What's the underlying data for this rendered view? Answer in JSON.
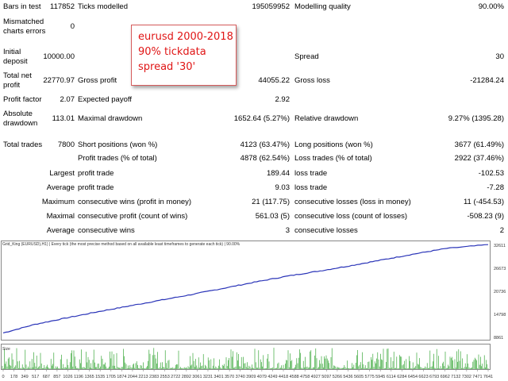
{
  "report": {
    "bars_label": "Bars in test",
    "bars_value": "117852",
    "ticks_label": "Ticks modelled",
    "ticks_value": "195059952",
    "quality_label": "Modelling quality",
    "quality_value": "90.00%",
    "mismatch_label": "Mismatched charts errors",
    "mismatch_value": "0",
    "deposit_label": "Initial deposit",
    "deposit_value": "10000.00",
    "spread_label": "Spread",
    "spread_value": "30",
    "netprofit_label": "Total net profit",
    "netprofit_value": "22770.97",
    "grossprofit_label": "Gross profit",
    "grossprofit_value": "44055.22",
    "grossloss_label": "Gross loss",
    "grossloss_value": "-21284.24",
    "pf_label": "Profit factor",
    "pf_value": "2.07",
    "ep_label": "Expected payoff",
    "ep_value": "2.92",
    "absdd_label": "Absolute drawdown",
    "absdd_value": "113.01",
    "maxdd_label": "Maximal drawdown",
    "maxdd_value": "1652.64 (5.27%)",
    "reldd_label": "Relative drawdown",
    "reldd_value": "9.27% (1395.28)",
    "trades_label": "Total trades",
    "trades_value": "7800",
    "short_label": "Short positions (won %)",
    "short_value": "4123 (63.47%)",
    "long_label": "Long positions (won %)",
    "long_value": "3677 (61.49%)",
    "pt_label": "Profit trades (% of total)",
    "pt_value": "4878 (62.54%)",
    "lt_label": "Loss trades (% of total)",
    "lt_value": "2922 (37.46%)",
    "largest": "Largest",
    "largest_pt_label": "profit trade",
    "largest_pt_value": "189.44",
    "largest_lt_label": "loss trade",
    "largest_lt_value": "-102.53",
    "average": "Average",
    "avg_pt_label": "profit trade",
    "avg_pt_value": "9.03",
    "avg_lt_label": "loss trade",
    "avg_lt_value": "-7.28",
    "maximum": "Maximum",
    "max_cw_label": "consecutive wins (profit in money)",
    "max_cw_value": "21 (117.75)",
    "max_cl_label": "consecutive losses (loss in money)",
    "max_cl_value": "11 (-454.53)",
    "maximal": "Maximal",
    "mal_cp_label": "consecutive profit (count of wins)",
    "mal_cp_value": "561.03 (5)",
    "mal_cl_label": "consecutive loss (count of losses)",
    "mal_cl_value": "-508.23 (9)",
    "average2": "Average",
    "avg_cw_label": "consecutive wins",
    "avg_cw_value": "3",
    "avg_cl_label": "consecutive losses",
    "avg_cl_value": "2"
  },
  "annotation": {
    "line1": "eurusd 2000-2018",
    "line2": "90% tickdata",
    "line3": "spread '30'"
  },
  "chart_header": "Grid_King (EURUSD),H1) | Every tick (the most precise method based on all available least timeframes to generate each tick) | 90.00%",
  "size_label": "Size",
  "colors": {
    "balance": "#2a34b8",
    "volume": "#1a9a1a",
    "note_text": "#e01515",
    "note_border": "#d65b5b"
  },
  "chart_data": {
    "type": "line",
    "title": "",
    "series": [
      {
        "values": [
          10000,
          12200,
          13900,
          15500,
          17000,
          18500,
          20000,
          21600,
          23200,
          24700,
          26000,
          27400,
          28900,
          30400,
          31800,
          32771
        ]
      }
    ],
    "x": [
      0,
      509,
      1026,
      1535,
      2044,
      2553,
      3061,
      3570,
      4079,
      4587,
      5096,
      5605,
      6114,
      6622,
      7131,
      7800
    ],
    "yticks": [
      "32611",
      "26673",
      "20736",
      "14798",
      "8861"
    ],
    "ylim": [
      8861,
      32611
    ],
    "xticks": [
      "0",
      "178",
      "349",
      "517",
      "687",
      "857",
      "1026",
      "1196",
      "1365",
      "1535",
      "1705",
      "1874",
      "2044",
      "2213",
      "2383",
      "2553",
      "2722",
      "2892",
      "3061",
      "3231",
      "3401",
      "3570",
      "3740",
      "3909",
      "4079",
      "4249",
      "4418",
      "4588",
      "4758",
      "4927",
      "5097",
      "5266",
      "5436",
      "5605",
      "5775",
      "5945",
      "6114",
      "6284",
      "6454",
      "6623",
      "6793",
      "6962",
      "7132",
      "7302",
      "7471",
      "7641"
    ],
    "xlabel": "",
    "ylabel": ""
  }
}
